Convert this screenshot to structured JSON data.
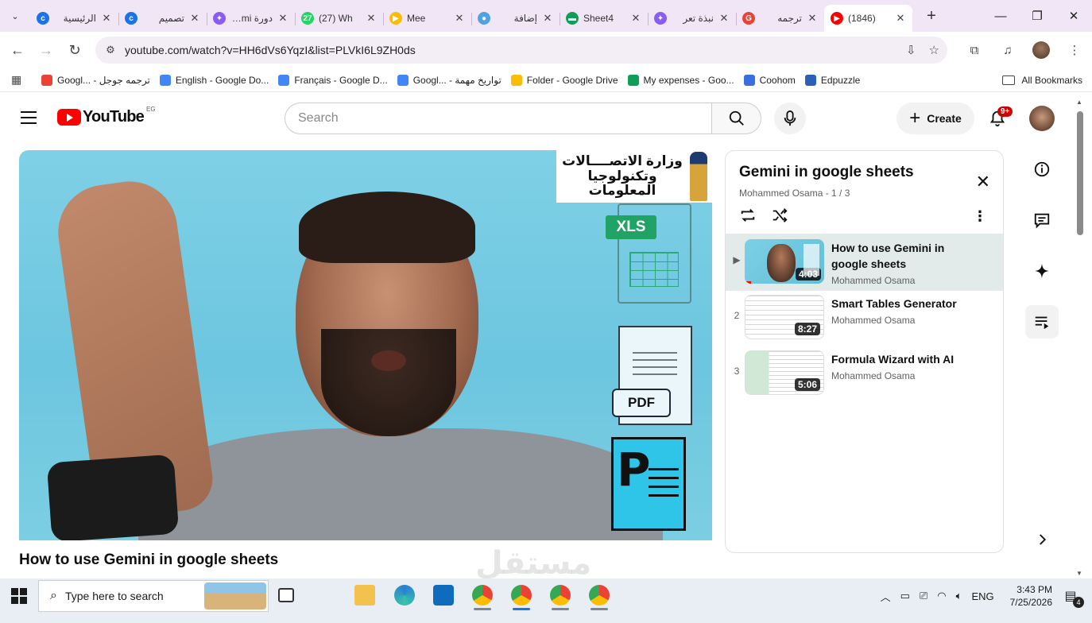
{
  "browser": {
    "tabs": [
      {
        "title": "الرئيسية",
        "favicon_color": "#1a73e8",
        "favicon_glyph": "c"
      },
      {
        "title": "تصميم",
        "favicon_color": "#1a73e8",
        "favicon_glyph": "c"
      },
      {
        "title": "دورة Gemi",
        "favicon_color": "#8a5cf6",
        "favicon_glyph": "✦"
      },
      {
        "title": "(27) Wh",
        "favicon_color": "#25d366",
        "favicon_glyph": "27"
      },
      {
        "title": "Mee",
        "favicon_color": "#fbbc04",
        "favicon_glyph": "▶"
      },
      {
        "title": "إضافة",
        "favicon_color": "#4fa3e0",
        "favicon_glyph": "●"
      },
      {
        "title": "Sheet4",
        "favicon_color": "#0f9d58",
        "favicon_glyph": "▬"
      },
      {
        "title": "نبذة تعر",
        "favicon_color": "#8a5cf6",
        "favicon_glyph": "✦"
      },
      {
        "title": "ترجمه",
        "favicon_color": "#ea4335",
        "favicon_glyph": "G"
      },
      {
        "title": "(1846)",
        "favicon_color": "#ff0000",
        "favicon_glyph": "▶"
      }
    ],
    "active_tab_index": 9,
    "url": "youtube.com/watch?v=HH6dVs6YqzI&list=PLVkI6L9ZH0ds",
    "bookmarks": [
      {
        "label": "Googl... - ترجمه جوجل",
        "color": "#ea4335"
      },
      {
        "label": "English - Google Do...",
        "color": "#4285f4"
      },
      {
        "label": "Français - Google D...",
        "color": "#4285f4"
      },
      {
        "label": "Googl... - تواريخ مهمة",
        "color": "#4285f4"
      },
      {
        "label": "Folder - Google Drive",
        "color": "#fbbc04"
      },
      {
        "label": "My expenses - Goo...",
        "color": "#0f9d58"
      },
      {
        "label": "Coohom",
        "color": "#3b6fe0"
      },
      {
        "label": "Edpuzzle",
        "color": "#2b5fb8"
      }
    ],
    "all_bookmarks_label": "All Bookmarks"
  },
  "youtube": {
    "logo_text": "YouTube",
    "country_code": "EG",
    "search_placeholder": "Search",
    "create_label": "Create",
    "notification_badge": "9+",
    "video": {
      "title": "How to use Gemini in google sheets",
      "overlay_ministry_text_line1": "وزارة الاتصــــالات",
      "overlay_ministry_text_line2": "وتكنولوجيا المعلومات",
      "xls_label": "XLS",
      "pdf_label": "PDF",
      "ppt_label": "P"
    },
    "playlist": {
      "title": "Gemini in google sheets",
      "subtitle": "Mohammed Osama - 1 / 3",
      "items": [
        {
          "index": "▶",
          "title": "How to use Gemini in google sheets",
          "channel": "Mohammed Osama",
          "duration": "4:03",
          "current": true
        },
        {
          "index": "2",
          "title": "Smart Tables Generator",
          "channel": "Mohammed Osama",
          "duration": "8:27",
          "current": false
        },
        {
          "index": "3",
          "title": "Formula Wizard with AI",
          "channel": "Mohammed Osama",
          "duration": "5:06",
          "current": false
        }
      ]
    },
    "watermark": "مستقل"
  },
  "taskbar": {
    "search_placeholder": "Type here to search",
    "language": "ENG",
    "time": "3:43 PM",
    "date": "7/25/2026",
    "notification_count": "4"
  }
}
